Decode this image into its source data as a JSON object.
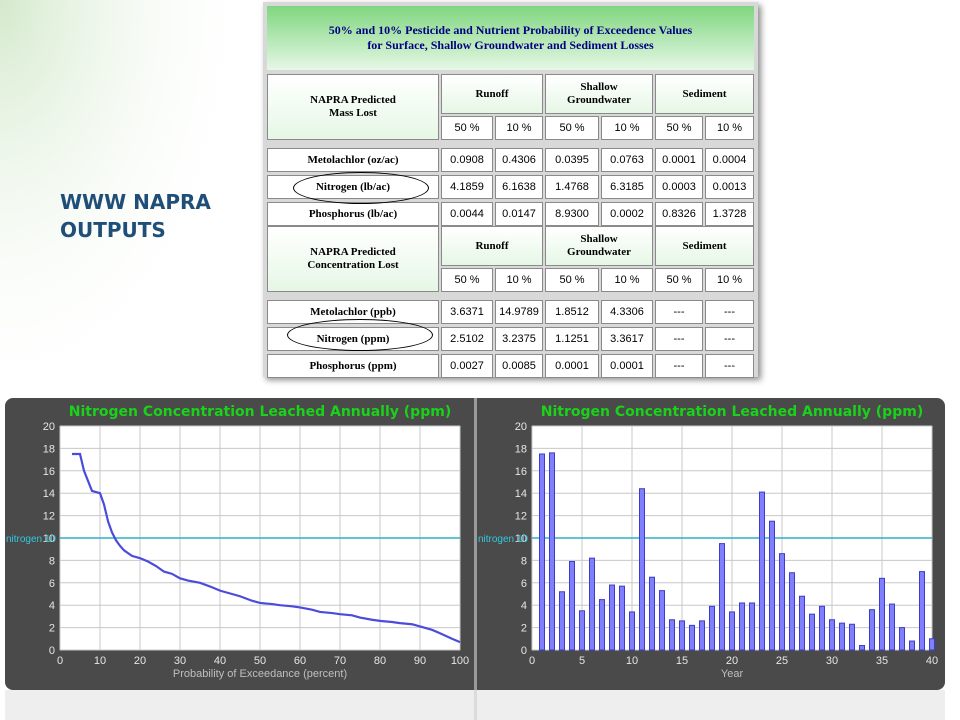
{
  "slide": {
    "title_line1": "WWW NAPRA",
    "title_line2": "OUTPUTS"
  },
  "table": {
    "header_line1": "50% and 10% Pesticide and Nutrient Probability of Exceedence Values",
    "header_line2": "for Surface, Shallow Groundwater and Sediment Losses",
    "sections": [
      {
        "label_line1": "NAPRA Predicted",
        "label_line2": "Mass Lost",
        "groups": [
          {
            "line1": "Runoff",
            "line2": ""
          },
          {
            "line1": "Shallow",
            "line2": "Groundwater"
          },
          {
            "line1": "Sediment",
            "line2": ""
          }
        ],
        "subheaders": [
          "50 %",
          "10 %",
          "50 %",
          "10 %",
          "50 %",
          "10 %"
        ],
        "rows": [
          {
            "label": "Metolachlor (oz/ac)",
            "values": [
              "0.0908",
              "0.4306",
              "0.0395",
              "0.0763",
              "0.0001",
              "0.0004"
            ]
          },
          {
            "label": "Nitrogen (lb/ac)",
            "values": [
              "4.1859",
              "6.1638",
              "1.4768",
              "6.3185",
              "0.0003",
              "0.0013"
            ]
          },
          {
            "label": "Phosphorus (lb/ac)",
            "values": [
              "0.0044",
              "0.0147",
              "8.9300",
              "0.0002",
              "0.8326",
              "1.3728"
            ]
          }
        ]
      },
      {
        "label_line1": "NAPRA Predicted",
        "label_line2": "Concentration Lost",
        "groups": [
          {
            "line1": "Runoff",
            "line2": ""
          },
          {
            "line1": "Shallow",
            "line2": "Groundwater"
          },
          {
            "line1": "Sediment",
            "line2": ""
          }
        ],
        "subheaders": [
          "50 %",
          "10 %",
          "50 %",
          "10 %",
          "50 %",
          "10 %"
        ],
        "rows": [
          {
            "label": "Metolachlor (ppb)",
            "values": [
              "3.6371",
              "14.9789",
              "1.8512",
              "4.3306",
              "---",
              "---"
            ]
          },
          {
            "label": "Nitrogen (ppm)",
            "values": [
              "2.5102",
              "3.2375",
              "1.1251",
              "3.3617",
              "---",
              "---"
            ]
          },
          {
            "label": "Phosphorus (ppm)",
            "values": [
              "0.0027",
              "0.0085",
              "0.0001",
              "0.0001",
              "---",
              "---"
            ]
          }
        ]
      }
    ]
  },
  "chart_data": [
    {
      "type": "line",
      "title": "Nitrogen Concentration Leached Annually (ppm)",
      "xlabel": "Probability of Exceedance (percent)",
      "ylabel": "",
      "xlim": [
        0,
        100
      ],
      "ylim": [
        0,
        20
      ],
      "xticks": [
        0,
        10,
        20,
        30,
        40,
        50,
        60,
        70,
        80,
        90,
        100
      ],
      "yticks": [
        0,
        2,
        4,
        6,
        8,
        10,
        12,
        14,
        16,
        18,
        20
      ],
      "grid": true,
      "reference_line": {
        "y": 10,
        "label": "nitrogen 10"
      },
      "series": [
        {
          "x": [
            3,
            5,
            6,
            8,
            10,
            11,
            12,
            13,
            14,
            15,
            16,
            18,
            20,
            22,
            24,
            26,
            28,
            30,
            32,
            35,
            38,
            40,
            43,
            45,
            48,
            50,
            53,
            55,
            58,
            60,
            63,
            65,
            68,
            70,
            73,
            75,
            78,
            80,
            83,
            85,
            88,
            90,
            93,
            95,
            98,
            100
          ],
          "y": [
            17.5,
            17.5,
            16.0,
            14.2,
            14.0,
            13.0,
            11.5,
            10.5,
            9.8,
            9.3,
            8.9,
            8.4,
            8.2,
            7.9,
            7.5,
            7.0,
            6.8,
            6.4,
            6.2,
            6.0,
            5.6,
            5.3,
            5.0,
            4.8,
            4.4,
            4.2,
            4.1,
            4.0,
            3.9,
            3.8,
            3.6,
            3.4,
            3.3,
            3.2,
            3.1,
            2.9,
            2.7,
            2.6,
            2.5,
            2.4,
            2.3,
            2.1,
            1.8,
            1.5,
            1.0,
            0.7
          ]
        }
      ]
    },
    {
      "type": "bar",
      "title": "Nitrogen Concentration Leached Annually (ppm)",
      "xlabel": "Year",
      "ylabel": "",
      "xlim": [
        0,
        40
      ],
      "ylim": [
        0,
        20
      ],
      "xticks": [
        0,
        5,
        10,
        15,
        20,
        25,
        30,
        35,
        40
      ],
      "yticks": [
        0,
        2,
        4,
        6,
        8,
        10,
        12,
        14,
        16,
        18,
        20
      ],
      "grid": true,
      "reference_line": {
        "y": 10,
        "label": "nitrogen 10"
      },
      "categories": [
        1,
        2,
        3,
        4,
        5,
        6,
        7,
        8,
        9,
        10,
        11,
        12,
        13,
        14,
        15,
        16,
        17,
        18,
        19,
        20,
        21,
        22,
        23,
        24,
        25,
        26,
        27,
        28,
        29,
        30,
        31,
        32,
        33,
        34,
        35,
        36,
        37,
        38,
        39,
        40
      ],
      "values": [
        17.5,
        17.6,
        5.2,
        7.9,
        3.5,
        8.2,
        4.5,
        5.8,
        5.7,
        3.4,
        14.4,
        6.5,
        5.3,
        2.7,
        2.6,
        2.2,
        2.6,
        3.9,
        9.5,
        3.4,
        4.2,
        4.2,
        14.1,
        11.5,
        8.6,
        6.9,
        4.8,
        3.2,
        3.9,
        2.7,
        2.4,
        2.3,
        0.4,
        3.6,
        6.4,
        4.1,
        2.0,
        0.8,
        7.0,
        1.0
      ]
    }
  ]
}
